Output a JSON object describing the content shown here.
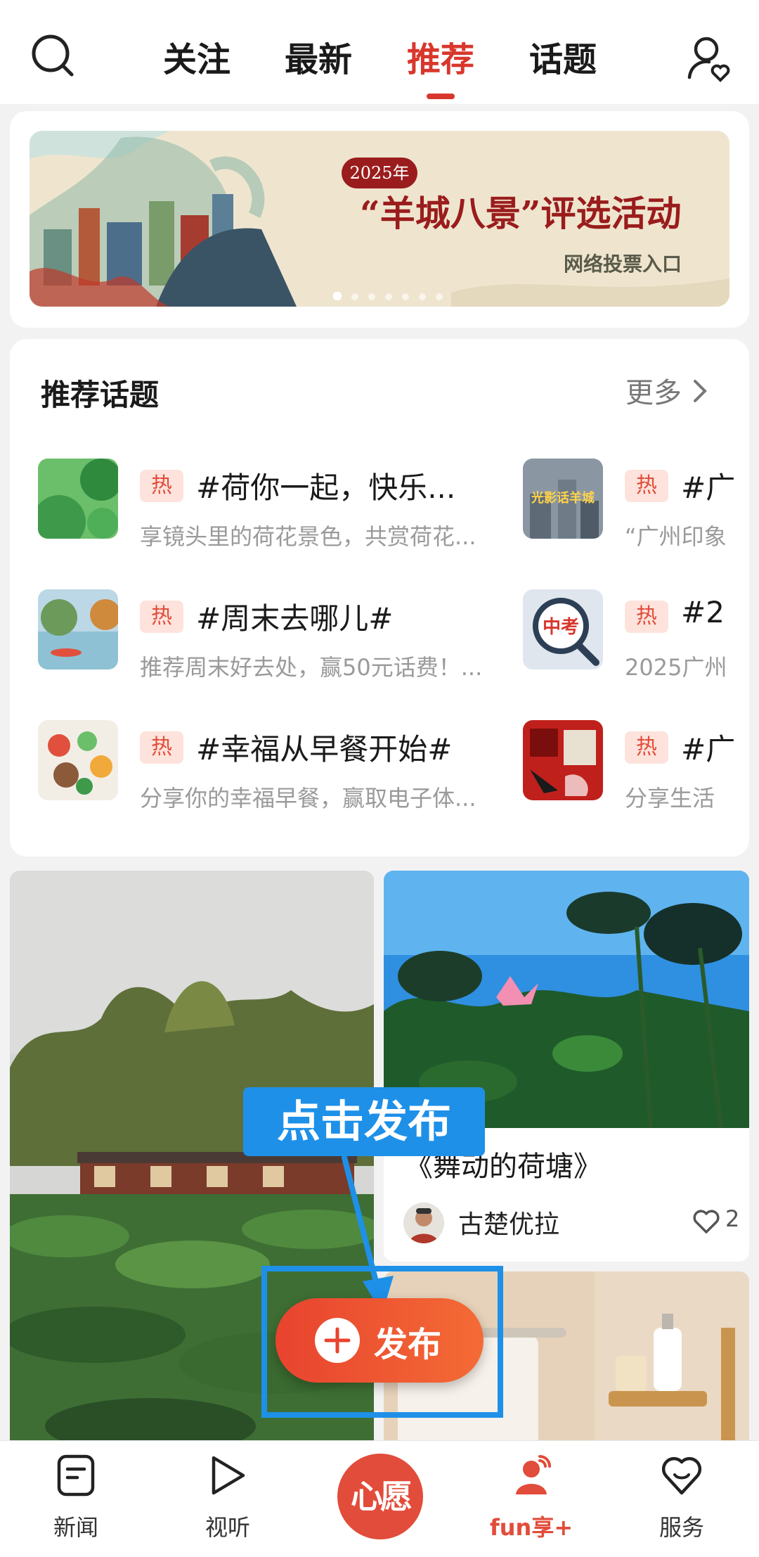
{
  "top_nav": {
    "tabs": [
      {
        "label": "关注"
      },
      {
        "label": "最新"
      },
      {
        "label": "推荐",
        "active": true
      },
      {
        "label": "话题"
      }
    ]
  },
  "banner": {
    "year_tag": "2025年",
    "title": "“羊城八景”评选活动",
    "subtitle": "网络投票入口",
    "slide_count": 7,
    "active_slide": 1
  },
  "topics": {
    "heading": "推荐话题",
    "more_label": "更多",
    "badge_label": "热",
    "items": [
      {
        "name": "#荷你一起，快乐...",
        "desc": "享镜头里的荷花景色，共赏荷花..."
      },
      {
        "name": "#广",
        "desc": "“广州印象"
      },
      {
        "name": "#周末去哪儿#",
        "desc": "推荐周末好去处，赢50元话费！..."
      },
      {
        "name": "#2",
        "desc": "2025广州"
      },
      {
        "name": "#幸福从早餐开始#",
        "desc": "分享你的幸福早餐，赢取电子体..."
      },
      {
        "name": "#广",
        "desc": "分享生活"
      }
    ],
    "thumb_labels": {
      "city": "光影话羊城",
      "exam": "中考"
    }
  },
  "feed": {
    "post": {
      "title": "《舞动的荷塘》",
      "author": "古楚优拉",
      "likes": "2"
    }
  },
  "overlay": {
    "callout": "点击发布",
    "publish_label": "发布"
  },
  "bottom_nav": {
    "items": [
      {
        "label": "新闻",
        "icon": "news-icon"
      },
      {
        "label": "视听",
        "icon": "play-icon"
      },
      {
        "label": "心愿",
        "icon": "wish-center-button"
      },
      {
        "label": "fun享+",
        "icon": "fun-person-icon",
        "active": true
      },
      {
        "label": "服务",
        "icon": "heart-smile-icon"
      }
    ]
  },
  "colors": {
    "accent": "#d8372d",
    "callout_blue": "#1e90e8",
    "hot_badge_bg": "#fde3dc"
  }
}
